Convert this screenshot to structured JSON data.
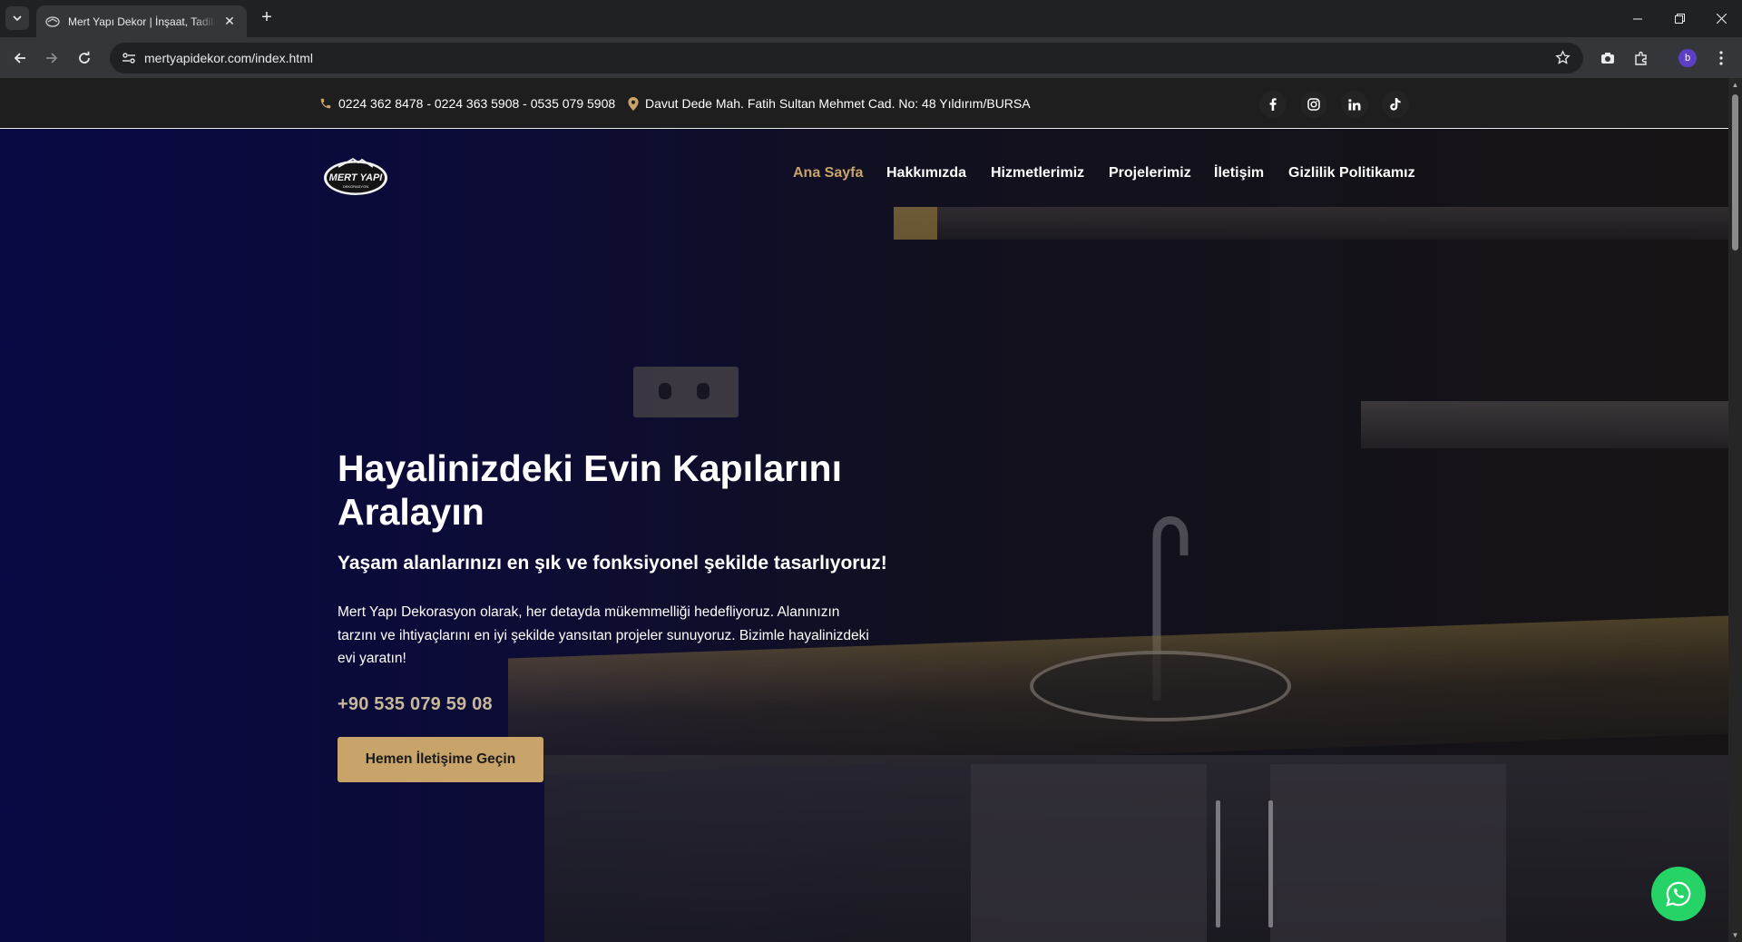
{
  "browser": {
    "tab_title": "Mert Yapı Dekor | İnşaat, Tadilat",
    "url": "mertyapidekor.com/index.html",
    "profile_initial": "b"
  },
  "topbar": {
    "phones": "0224 362 8478 - 0224 363 5908 - 0535 079 5908",
    "address": "Davut Dede Mah. Fatih Sultan Mehmet Cad. No: 48 Yıldırım/BURSA",
    "socials": [
      "facebook-icon",
      "instagram-icon",
      "linkedin-icon",
      "tiktok-icon"
    ]
  },
  "logo": {
    "text_main": "MERT YAPI",
    "text_sub": "DEKORASYON"
  },
  "nav": {
    "items": [
      {
        "label": "Ana Sayfa",
        "active": true
      },
      {
        "label": "Hakkımızda",
        "active": false
      },
      {
        "label": "Hizmetlerimiz",
        "active": false
      },
      {
        "label": "Projelerimiz",
        "active": false
      },
      {
        "label": "İletişim",
        "active": false
      },
      {
        "label": "Gizlilik Politikamız",
        "active": false
      }
    ]
  },
  "hero": {
    "title": "Hayalinizdeki Evin Kapılarını Aralayın",
    "subtitle": "Yaşam alanlarınızı en şık ve fonksiyonel şekilde tasarlıyoruz!",
    "text": "Mert Yapı Dekorasyon olarak, her detayda mükemmelliği hedefliyoruz. Alanınızın tarzını ve ihtiyaçlarını en iyi şekilde yansıtan projeler sunuyoruz. Bizimle hayalinizdeki evi yaratın!",
    "phone": "+90 535 079 59 08",
    "cta_label": "Hemen İletişime Geçin"
  },
  "colors": {
    "accent": "#c8a46a",
    "topbar_bg": "#1e1e1e",
    "hero_overlay": "#08084a",
    "whatsapp": "#25d366"
  }
}
